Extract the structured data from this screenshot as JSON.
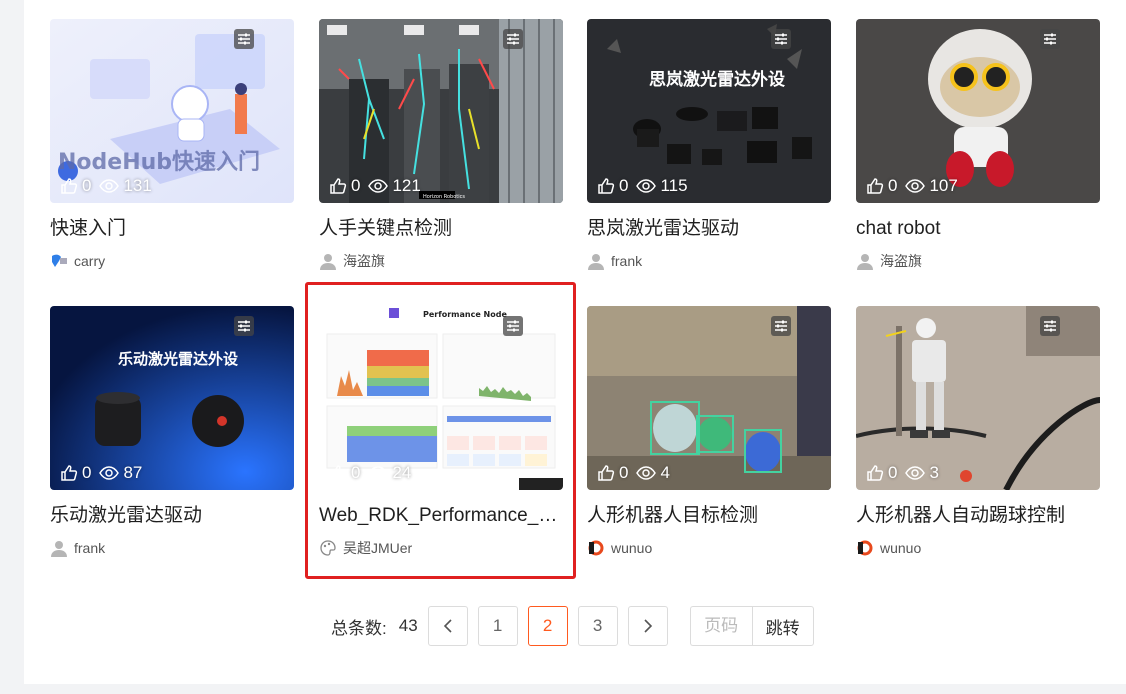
{
  "cards": [
    {
      "title": "快速入门",
      "author": "carry",
      "likes": "0",
      "views": "131",
      "thumb_text": "NodeHub快速入门"
    },
    {
      "title": "人手关键点检测",
      "author": "海盗旗",
      "likes": "0",
      "views": "121",
      "thumb_text": "Horizon Robotics"
    },
    {
      "title": "思岚激光雷达驱动",
      "author": "frank",
      "likes": "0",
      "views": "115",
      "thumb_text": "思岚激光雷达外设"
    },
    {
      "title": "chat robot",
      "author": "海盗旗",
      "likes": "0",
      "views": "107"
    },
    {
      "title": "乐动激光雷达驱动",
      "author": "frank",
      "likes": "0",
      "views": "87",
      "thumb_text": "乐动激光雷达外设"
    },
    {
      "title": "Web_RDK_Performance_Node",
      "author": "吴超JMUer",
      "likes": "0",
      "views": "24",
      "thumb_text": "Performance Node"
    },
    {
      "title": "人形机器人目标检测",
      "author": "wunuo",
      "likes": "0",
      "views": "4"
    },
    {
      "title": "人形机器人自动踢球控制",
      "author": "wunuo",
      "likes": "0",
      "views": "3"
    }
  ],
  "pagination": {
    "total_label": "总条数:",
    "total": "43",
    "pages": [
      "1",
      "2",
      "3"
    ],
    "current": "2",
    "jump_placeholder": "页码",
    "jump_label": "跳转"
  },
  "colors": {
    "accent": "#ff5a1f",
    "highlight": "#e02020"
  }
}
